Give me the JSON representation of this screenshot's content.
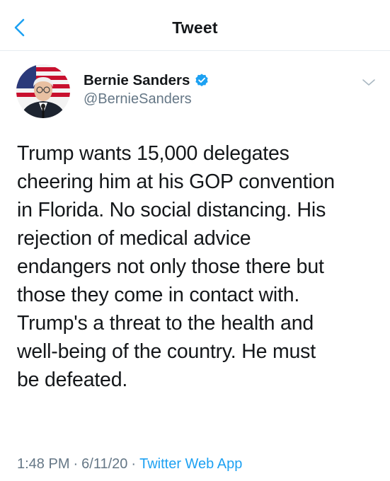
{
  "colors": {
    "accent": "#1da1f2",
    "text": "#14171a",
    "muted": "#657786",
    "divider": "#e6ecf0"
  },
  "nav": {
    "title": "Tweet",
    "back_icon": "chevron-left-icon"
  },
  "author": {
    "display_name": "Bernie Sanders",
    "handle": "@BernieSanders",
    "verified": true,
    "verified_icon": "verified-badge-icon"
  },
  "menu_icon": "chevron-down-icon",
  "tweet": {
    "lines": [
      "Trump wants 15,000 delegates",
      "cheering him at his GOP convention",
      "in Florida. No social distancing. His",
      "rejection of medical advice",
      "endangers not only those there but",
      "those they come in contact with.",
      "Trump's a threat to the health and",
      "well-being of the country. He must",
      "be defeated."
    ]
  },
  "meta": {
    "time": "1:48 PM",
    "separator": "·",
    "date": "6/11/20",
    "source": "Twitter Web App"
  }
}
